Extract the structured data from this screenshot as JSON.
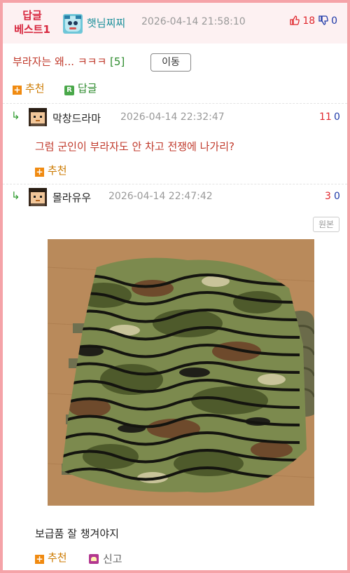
{
  "header": {
    "badge_line1": "답글",
    "badge_line2": "베스트1",
    "author": "햇님찌찌",
    "timestamp": "2026-04-14 21:58:10",
    "upvotes": "18",
    "downvotes": "0"
  },
  "post": {
    "title": "부라자는 왜... ㅋㅋㅋ",
    "comment_count": "[5]",
    "move_label": "이동",
    "recommend_label": "추천",
    "reply_icon": "R",
    "reply_label": "답글"
  },
  "replies": [
    {
      "author": "막창드라마",
      "timestamp": "2026-04-14 22:32:47",
      "upvotes": "11",
      "downvotes": "0",
      "text": "그럼 군인이 부라자도 안 차고 전쟁에 나가리?",
      "recommend_label": "추천"
    },
    {
      "author": "몰라유우",
      "timestamp": "2026-04-14 22:47:42",
      "upvotes": "3",
      "downvotes": "0",
      "original_label": "원본",
      "text": "보급품 잘 챙겨야지",
      "recommend_label": "추천",
      "report_label": "신고"
    }
  ],
  "icons": {
    "reply_arrow": "↳",
    "plus": "+"
  },
  "colors": {
    "border": "#f5a3a8",
    "badge": "#d7263d",
    "upvote": "#e0282e",
    "downvote": "#1f3aa8"
  }
}
